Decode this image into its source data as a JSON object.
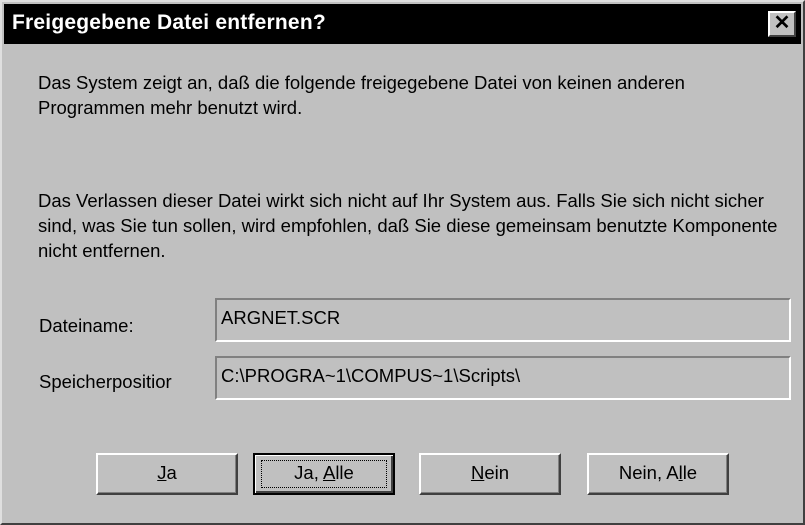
{
  "dialog": {
    "title": "Freigegebene Datei entfernen?",
    "close_glyph": "✕",
    "message_1": "Das System zeigt an, daß die folgende freigegebene Datei von keinen anderen Programmen mehr benutzt wird.",
    "message_2": "Das Verlassen dieser Datei wirkt sich nicht auf Ihr System aus. Falls Sie sich nicht sicher sind, was Sie tun sollen, wird empfohlen, daß Sie diese gemeinsam benutzte Komponente nicht entfernen."
  },
  "fields": {
    "filename_label": "Dateiname:",
    "filename_value": "ARGNET.SCR",
    "location_label": "Speicherpositior",
    "location_value": "C:\\PROGRA~1\\COMPUS~1\\Scripts\\"
  },
  "buttons": [
    {
      "pre": "",
      "mnemonic": "J",
      "post": "a"
    },
    {
      "pre": "Ja, ",
      "mnemonic": "A",
      "post": "lle"
    },
    {
      "pre": "",
      "mnemonic": "N",
      "post": "ein"
    },
    {
      "pre": "Nein, A",
      "mnemonic": "l",
      "post": "le"
    }
  ],
  "colors": {
    "face": "#c0c0c0",
    "titlebar": "#000000",
    "title_text": "#ffffff"
  }
}
